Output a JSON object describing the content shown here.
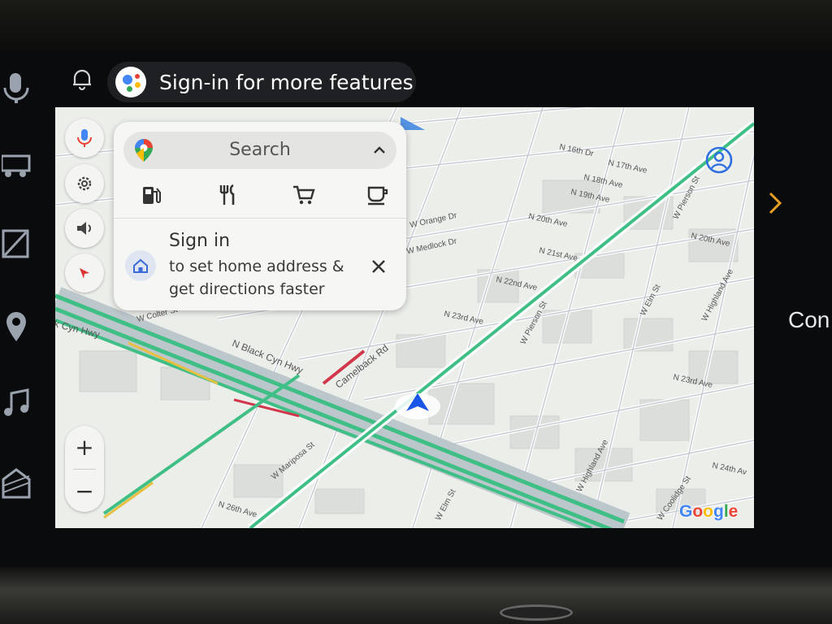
{
  "status_bar": {
    "assistant_prompt": "Sign-in for more features"
  },
  "search_card": {
    "search_label": "Search",
    "categories": [
      {
        "name": "gas-station"
      },
      {
        "name": "restaurants"
      },
      {
        "name": "grocery"
      },
      {
        "name": "coffee"
      }
    ],
    "signin_title": "Sign in",
    "signin_line1": "to set home address &",
    "signin_line2": "get directions faster"
  },
  "map": {
    "labels": {
      "black_cyn_hwy": "N Black Cyn Hwy",
      "camelback": "Camelback Rd",
      "n21": "N 21st Ave",
      "n22": "N 22nd Ave",
      "n23": "N 23rd Ave",
      "n23b": "N 23rd Ave",
      "n20": "N 20th Ave",
      "n20b": "N 20th Ave",
      "n24": "N 24th Av",
      "n26": "N 26th Ave",
      "n19": "N 19th Ave",
      "n18": "N 18th Ave",
      "n17": "N 17th Ave",
      "n16": "N 16th Dr",
      "pierson": "W Pierson St",
      "pierson2": "W Pierson St",
      "elm": "W Elm St",
      "elm2": "W Elm St",
      "highland": "W Highland Ave",
      "highland2": "W Highland Ave",
      "mariposa": "W Mariposa St",
      "coolidge": "W Coolidge St",
      "orange": "W Orange Dr",
      "medlock": "W Medlock Dr",
      "cyn_hwy": "k Cyn Hwy",
      "colter": "W Colter St"
    },
    "attribution": "Google"
  },
  "right_panel": {
    "text": "Con"
  },
  "zoom": {
    "in": "+",
    "out": "−"
  },
  "colors": {
    "map_bg": "#eceeea",
    "traffic_green": "#3fbf86",
    "traffic_red": "#d1364a",
    "nav_blue": "#1a56e8"
  }
}
